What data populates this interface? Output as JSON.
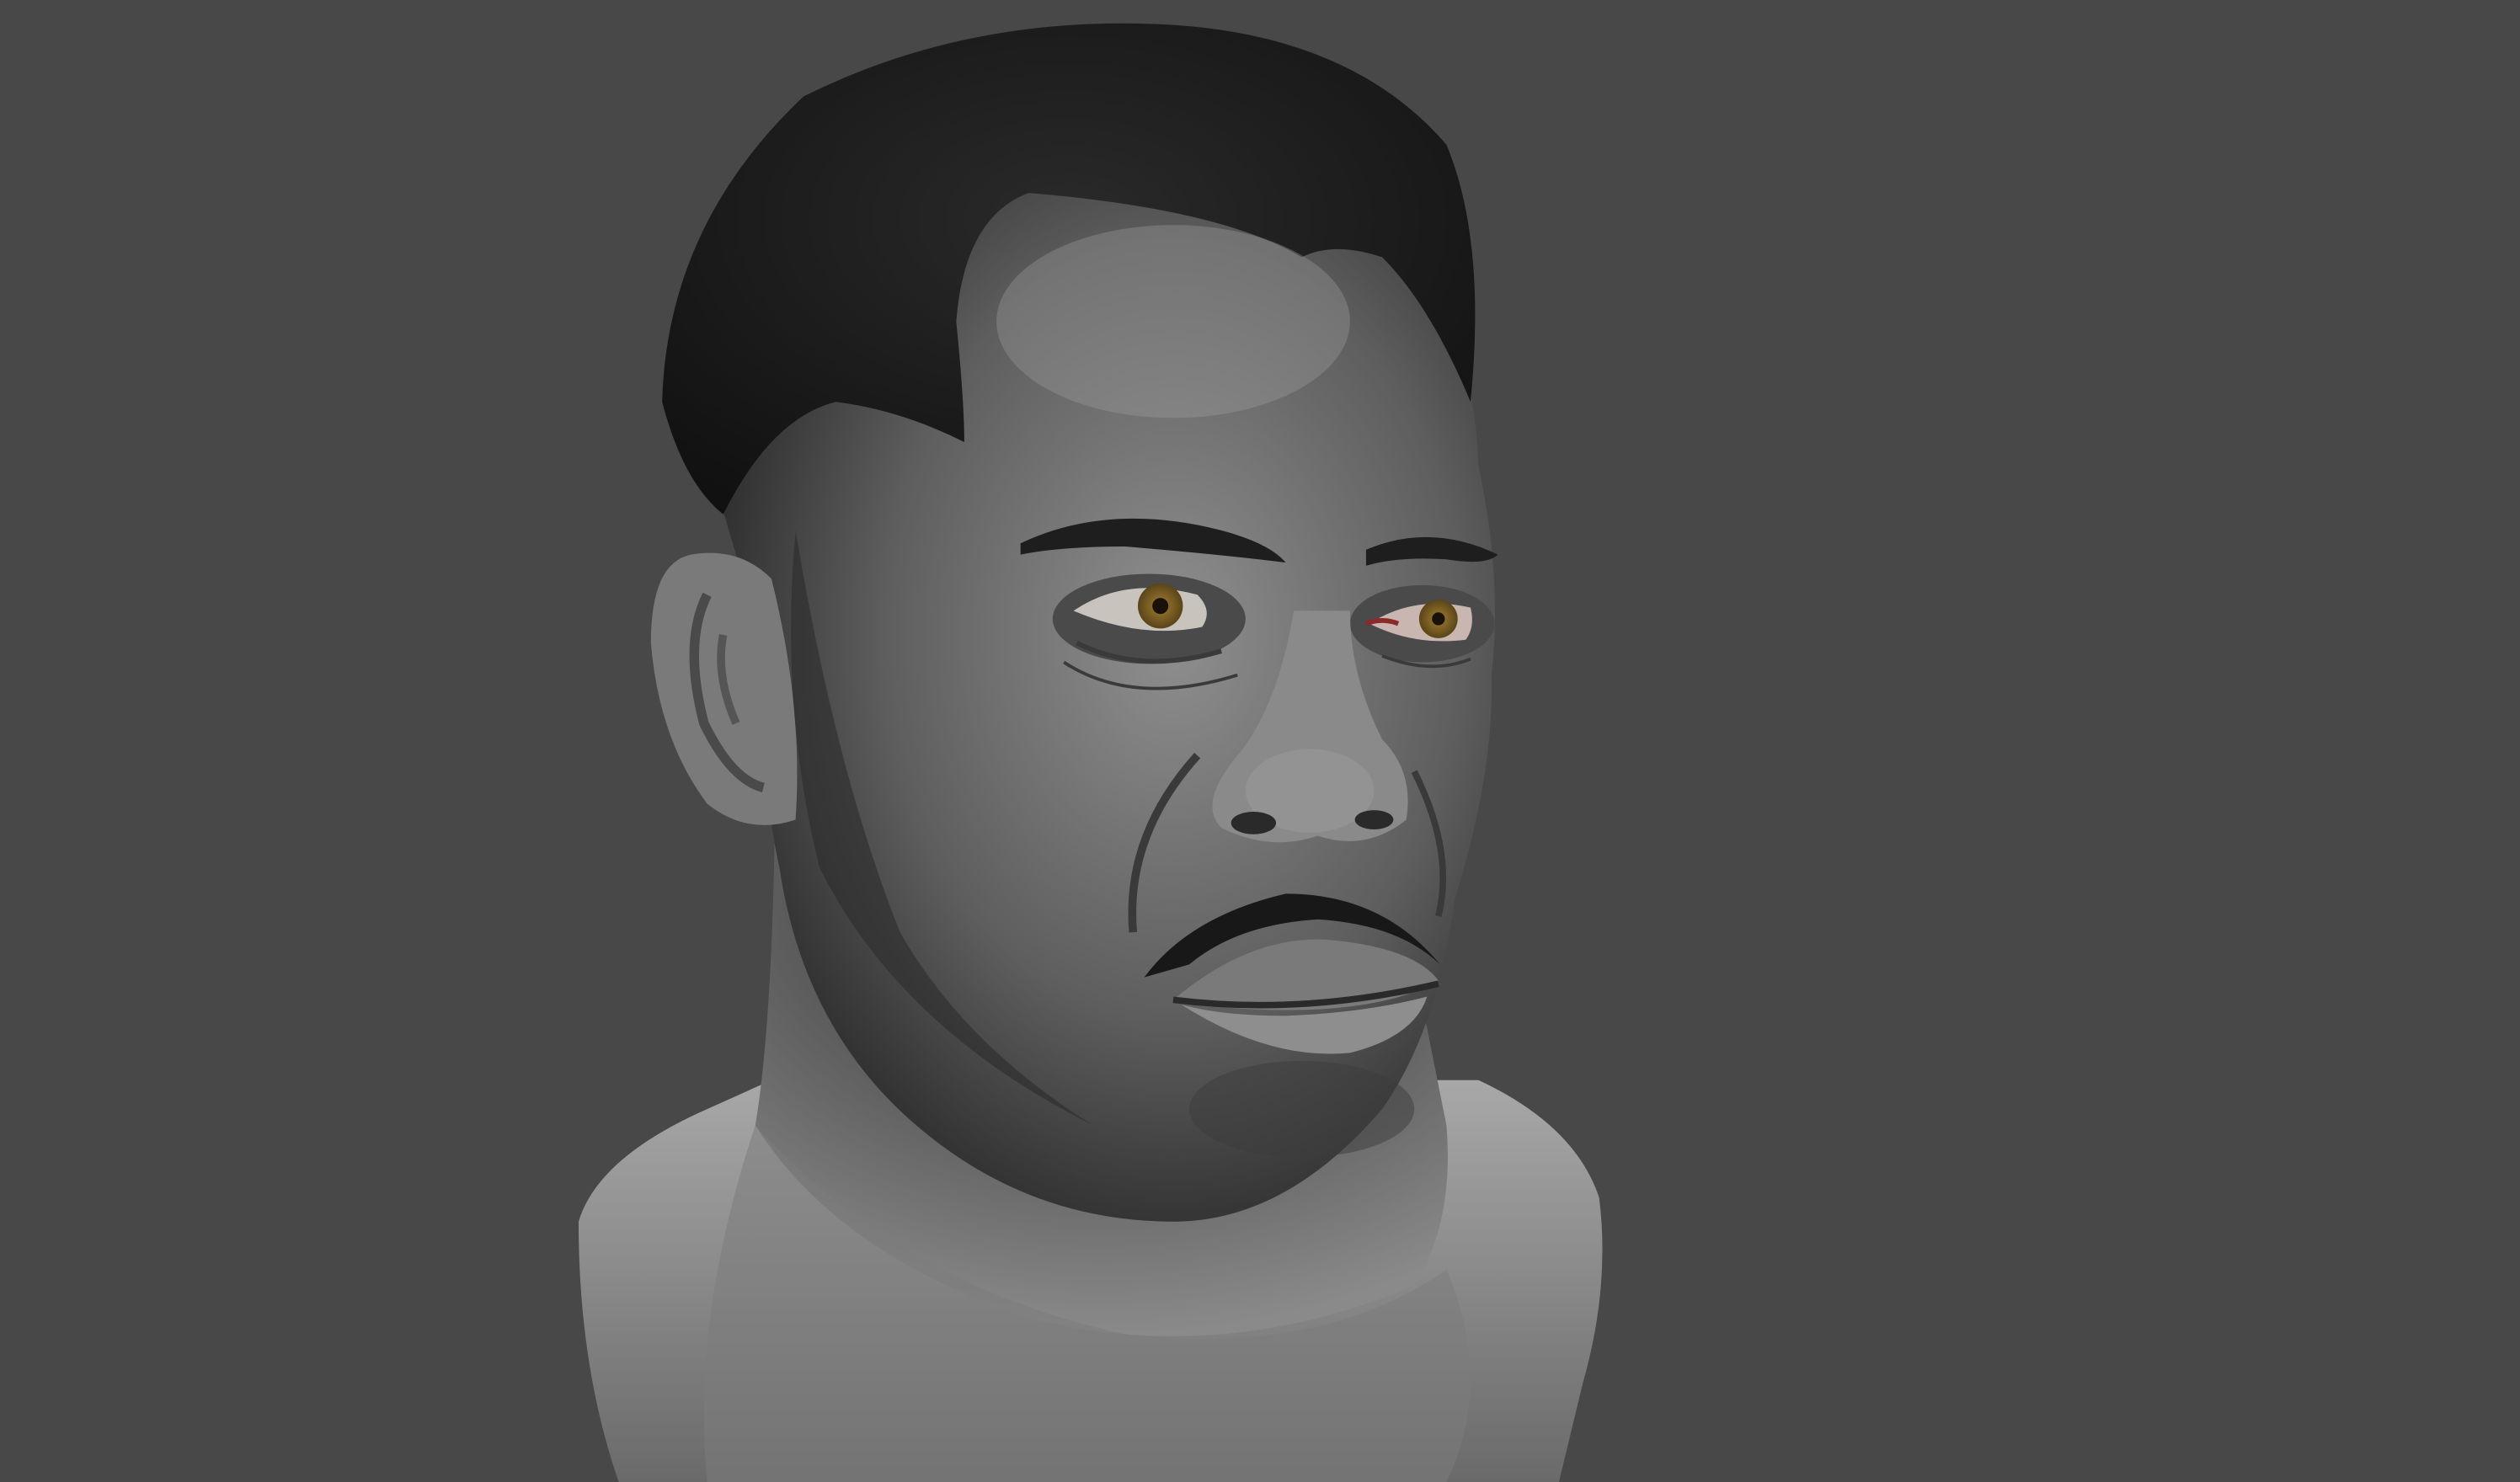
{
  "viewport": {
    "background_color": "#484848",
    "subject": "sculpted-head-bust",
    "material_color": "#8a8a8a",
    "hair_color": "#1c1c1c",
    "iris_color": "#8a6a2a"
  }
}
